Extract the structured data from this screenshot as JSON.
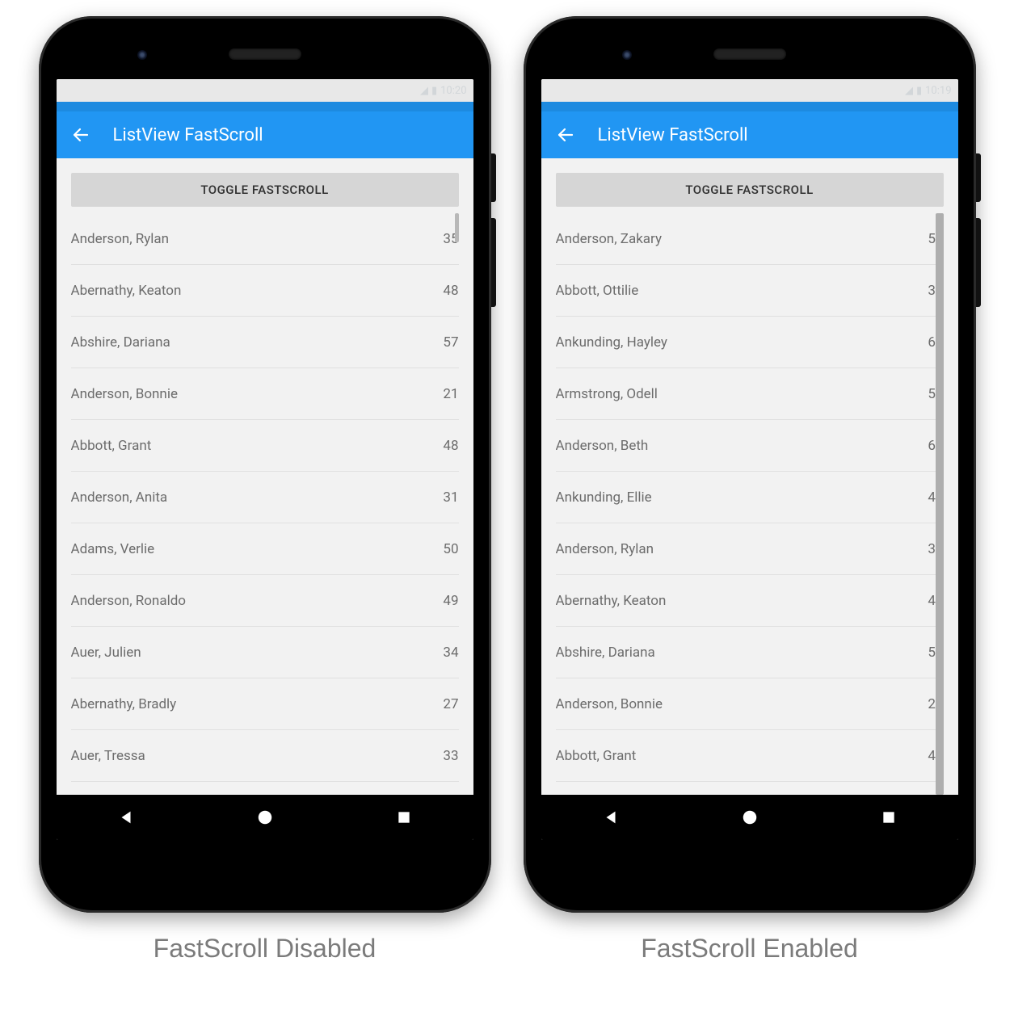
{
  "colors": {
    "primary": "#2196F3",
    "primary_dark": "#1d8ae0",
    "button_bg": "#d6d6d6",
    "text_muted": "#6c6c6c"
  },
  "left": {
    "app_title": "ListView FastScroll",
    "status_time": "10:20",
    "toggle_label": "TOGGLE FASTSCROLL",
    "fastscroll_enabled": false,
    "caption": "FastScroll Disabled",
    "rows": [
      {
        "name": "Anderson, Rylan",
        "value": 35
      },
      {
        "name": "Abernathy, Keaton",
        "value": 48
      },
      {
        "name": "Abshire, Dariana",
        "value": 57
      },
      {
        "name": "Anderson, Bonnie",
        "value": 21
      },
      {
        "name": "Abbott, Grant",
        "value": 48
      },
      {
        "name": "Anderson, Anita",
        "value": 31
      },
      {
        "name": "Adams, Verlie",
        "value": 50
      },
      {
        "name": "Anderson, Ronaldo",
        "value": 49
      },
      {
        "name": "Auer, Julien",
        "value": 34
      },
      {
        "name": "Abernathy, Bradly",
        "value": 27
      },
      {
        "name": "Auer, Tressa",
        "value": 33
      }
    ]
  },
  "right": {
    "app_title": "ListView FastScroll",
    "status_time": "10:19",
    "toggle_label": "TOGGLE FASTSCROLL",
    "fastscroll_enabled": true,
    "caption": "FastScroll Enabled",
    "rows": [
      {
        "name": "Anderson, Zakary",
        "value": 57
      },
      {
        "name": "Abbott, Ottilie",
        "value": 39
      },
      {
        "name": "Ankunding, Hayley",
        "value": 60
      },
      {
        "name": "Armstrong, Odell",
        "value": 50
      },
      {
        "name": "Anderson, Beth",
        "value": 62
      },
      {
        "name": "Ankunding, Ellie",
        "value": 45
      },
      {
        "name": "Anderson, Rylan",
        "value": 35
      },
      {
        "name": "Abernathy, Keaton",
        "value": 48
      },
      {
        "name": "Abshire, Dariana",
        "value": 57
      },
      {
        "name": "Anderson, Bonnie",
        "value": 21
      },
      {
        "name": "Abbott, Grant",
        "value": 48
      }
    ]
  }
}
